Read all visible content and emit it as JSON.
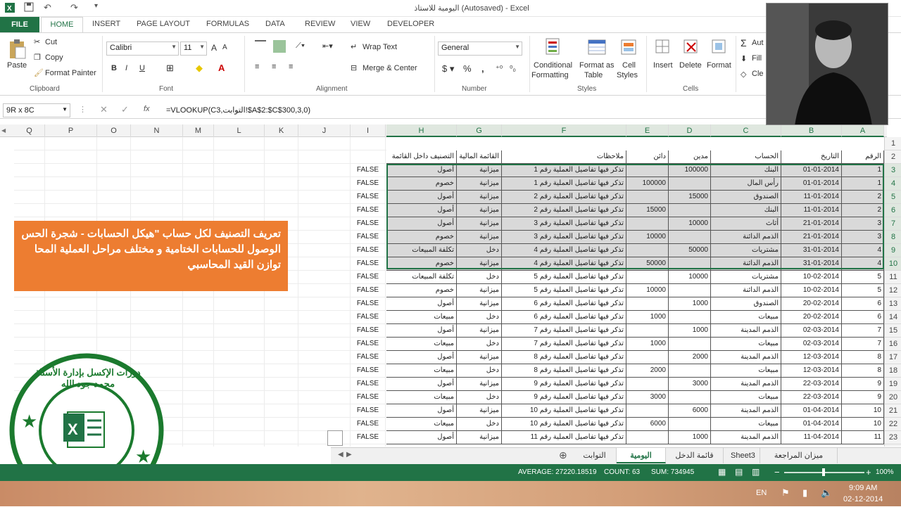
{
  "window": {
    "title": "اليومية للاستاذ (Autosaved) - Excel"
  },
  "ribbon_tabs": [
    "FILE",
    "HOME",
    "INSERT",
    "PAGE LAYOUT",
    "FORMULAS",
    "DATA",
    "REVIEW",
    "VIEW",
    "DEVELOPER"
  ],
  "clipboard": {
    "paste": "Paste",
    "cut": "Cut",
    "copy": "Copy",
    "format_painter": "Format Painter",
    "label": "Clipboard"
  },
  "font": {
    "name": "Calibri",
    "size": "11",
    "label": "Font"
  },
  "alignment": {
    "wrap": "Wrap Text",
    "merge": "Merge & Center",
    "label": "Alignment"
  },
  "number": {
    "format": "General",
    "label": "Number"
  },
  "styles": {
    "conditional": "Conditional",
    "formatting": "Formatting",
    "format_as": "Format as",
    "table": "Table",
    "cell": "Cell",
    "cell_styles": "Styles",
    "label": "Styles"
  },
  "cells": {
    "insert": "Insert",
    "delete": "Delete",
    "format": "Format",
    "label": "Cells"
  },
  "editing": {
    "autosum": "Aut",
    "fill": "Fill",
    "clear": "Cle"
  },
  "formula_bar": {
    "name_box": "9R x 8C",
    "formula": "=VLOOKUP(C3,التوابت!$A$2:$C$300,3,0)"
  },
  "columns": [
    "Q",
    "P",
    "O",
    "N",
    "M",
    "L",
    "K",
    "J",
    "I",
    "H",
    "G",
    "F",
    "E",
    "D",
    "C",
    "B",
    "A"
  ],
  "header_row": {
    "A": "الرقم",
    "B": "التاريخ",
    "C": "الحساب",
    "D": "مدين",
    "E": "دائن",
    "F": "ملاحظات",
    "G": "القائمة المالية",
    "H": "التصنيف داخل القائمة"
  },
  "rows": [
    {
      "n": "3",
      "A": "1",
      "B": "01-01-2014",
      "C": "البنك",
      "D": "100000",
      "E": "",
      "F": "تذكر فيها تفاصيل العملية رقم 1",
      "G": "ميزانية",
      "H": "أصول",
      "I": "FALSE"
    },
    {
      "n": "4",
      "A": "1",
      "B": "01-01-2014",
      "C": "رأس المال",
      "D": "",
      "E": "100000",
      "F": "تذكر فيها تفاصيل العملية رقم 1",
      "G": "ميزانية",
      "H": "خصوم",
      "I": "FALSE"
    },
    {
      "n": "5",
      "A": "2",
      "B": "11-01-2014",
      "C": "الصندوق",
      "D": "15000",
      "E": "",
      "F": "تذكر فيها تفاصيل العملية رقم 2",
      "G": "ميزانية",
      "H": "أصول",
      "I": "FALSE"
    },
    {
      "n": "6",
      "A": "2",
      "B": "11-01-2014",
      "C": "البنك",
      "D": "",
      "E": "15000",
      "F": "تذكر فيها تفاصيل العملية رقم 2",
      "G": "ميزانية",
      "H": "أصول",
      "I": "FALSE"
    },
    {
      "n": "7",
      "A": "3",
      "B": "21-01-2014",
      "C": "أثاث",
      "D": "10000",
      "E": "",
      "F": "تذكر فيها تفاصيل العملية رقم 3",
      "G": "ميزانية",
      "H": "أصول",
      "I": "FALSE"
    },
    {
      "n": "8",
      "A": "3",
      "B": "21-01-2014",
      "C": "الذمم الدائنة",
      "D": "",
      "E": "10000",
      "F": "تذكر فيها تفاصيل العملية رقم 3",
      "G": "ميزانية",
      "H": "خصوم",
      "I": "FALSE"
    },
    {
      "n": "9",
      "A": "4",
      "B": "31-01-2014",
      "C": "مشتريات",
      "D": "50000",
      "E": "",
      "F": "تذكر فيها تفاصيل العملية رقم 4",
      "G": "دخل",
      "H": "تكلفة المبيعات",
      "I": "FALSE"
    },
    {
      "n": "10",
      "A": "4",
      "B": "31-01-2014",
      "C": "الذمم الدائنة",
      "D": "",
      "E": "50000",
      "F": "تذكر فيها تفاصيل العملية رقم 4",
      "G": "ميزانية",
      "H": "خصوم",
      "I": "FALSE"
    },
    {
      "n": "11",
      "A": "5",
      "B": "10-02-2014",
      "C": "مشتريات",
      "D": "10000",
      "E": "",
      "F": "تذكر فيها تفاصيل العملية رقم 5",
      "G": "دخل",
      "H": "تكلفة المبيعات",
      "I": "FALSE"
    },
    {
      "n": "12",
      "A": "5",
      "B": "10-02-2014",
      "C": "الذمم الدائنة",
      "D": "",
      "E": "10000",
      "F": "تذكر فيها تفاصيل العملية رقم 5",
      "G": "ميزانية",
      "H": "خصوم",
      "I": "FALSE"
    },
    {
      "n": "13",
      "A": "6",
      "B": "20-02-2014",
      "C": "الصندوق",
      "D": "1000",
      "E": "",
      "F": "تذكر فيها تفاصيل العملية رقم 6",
      "G": "ميزانية",
      "H": "أصول",
      "I": "FALSE"
    },
    {
      "n": "14",
      "A": "6",
      "B": "20-02-2014",
      "C": "مبيعات",
      "D": "",
      "E": "1000",
      "F": "تذكر فيها تفاصيل العملية رقم 6",
      "G": "دخل",
      "H": "مبيعات",
      "I": "FALSE"
    },
    {
      "n": "15",
      "A": "7",
      "B": "02-03-2014",
      "C": "الذمم المدينة",
      "D": "1000",
      "E": "",
      "F": "تذكر فيها تفاصيل العملية رقم 7",
      "G": "ميزانية",
      "H": "أصول",
      "I": "FALSE"
    },
    {
      "n": "16",
      "A": "7",
      "B": "02-03-2014",
      "C": "مبيعات",
      "D": "",
      "E": "1000",
      "F": "تذكر فيها تفاصيل العملية رقم 7",
      "G": "دخل",
      "H": "مبيعات",
      "I": "FALSE"
    },
    {
      "n": "17",
      "A": "8",
      "B": "12-03-2014",
      "C": "الذمم المدينة",
      "D": "2000",
      "E": "",
      "F": "تذكر فيها تفاصيل العملية رقم 8",
      "G": "ميزانية",
      "H": "أصول",
      "I": "FALSE"
    },
    {
      "n": "18",
      "A": "8",
      "B": "12-03-2014",
      "C": "مبيعات",
      "D": "",
      "E": "2000",
      "F": "تذكر فيها تفاصيل العملية رقم 8",
      "G": "دخل",
      "H": "مبيعات",
      "I": "FALSE"
    },
    {
      "n": "19",
      "A": "9",
      "B": "22-03-2014",
      "C": "الذمم المدينة",
      "D": "3000",
      "E": "",
      "F": "تذكر فيها تفاصيل العملية رقم 9",
      "G": "ميزانية",
      "H": "أصول",
      "I": "FALSE"
    },
    {
      "n": "20",
      "A": "9",
      "B": "22-03-2014",
      "C": "مبيعات",
      "D": "",
      "E": "3000",
      "F": "تذكر فيها تفاصيل العملية رقم 9",
      "G": "دخل",
      "H": "مبيعات",
      "I": "FALSE"
    },
    {
      "n": "21",
      "A": "10",
      "B": "01-04-2014",
      "C": "الذمم المدينة",
      "D": "6000",
      "E": "",
      "F": "تذكر فيها تفاصيل العملية رقم 10",
      "G": "ميزانية",
      "H": "أصول",
      "I": "FALSE"
    },
    {
      "n": "22",
      "A": "10",
      "B": "01-04-2014",
      "C": "مبيعات",
      "D": "",
      "E": "6000",
      "F": "تذكر فيها تفاصيل العملية رقم 10",
      "G": "دخل",
      "H": "مبيعات",
      "I": "FALSE"
    },
    {
      "n": "23",
      "A": "11",
      "B": "11-04-2014",
      "C": "الذمم المدينة",
      "D": "1000",
      "E": "",
      "F": "تذكر فيها تفاصيل العملية رقم 11",
      "G": "ميزانية",
      "H": "أصول",
      "I": "FALSE"
    }
  ],
  "callout": {
    "line1": "تعريف التصنيف لكل حساب \"هيكل الحسابات - شجرة الحس",
    "line2": "الوصول للحسابات الختامية و مختلف مراحل العملية المحا",
    "line3": "توازن القيد المحاسبي"
  },
  "seal_text": "دورات الإكسل بإدارة الأستاذ محمد جود الله",
  "sheet_tabs": [
    "التوابت",
    "اليومية",
    "قائمة الدخل",
    "Sheet3",
    "ميزان المراجعة"
  ],
  "active_sheet": "اليومية",
  "status": {
    "average": "AVERAGE: 27220.18519",
    "count": "COUNT: 63",
    "sum": "SUM: 734945",
    "zoom": "100%"
  },
  "taskbar": {
    "lang": "EN",
    "time": "9:09 AM",
    "date": "02-12-2014"
  },
  "colors": {
    "excel_green": "#217346",
    "callout_orange": "#ed7d31",
    "selection_gray": "#d9d9d9"
  }
}
